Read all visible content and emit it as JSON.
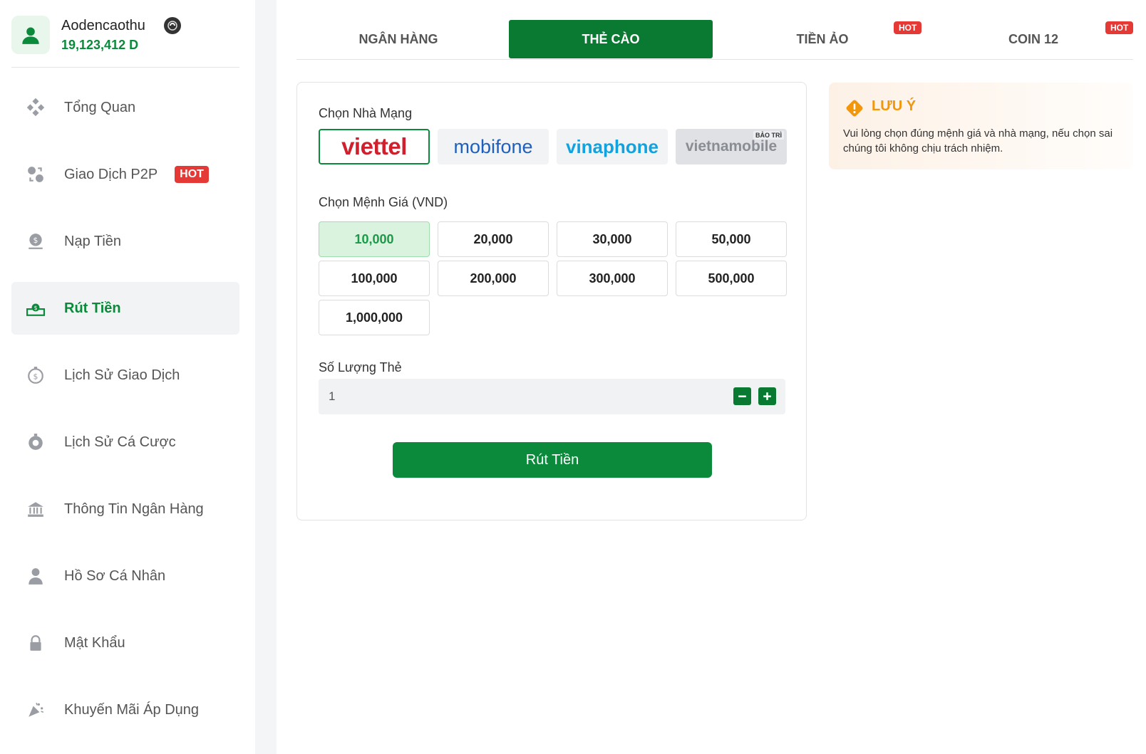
{
  "user": {
    "name": "Aodencaothu",
    "balance": "19,123,412 D"
  },
  "sidebar": {
    "items": [
      {
        "label": "Tổng Quan",
        "icon": "dashboard-icon"
      },
      {
        "label": "Giao Dịch P2P",
        "icon": "p2p-exchange-icon",
        "badge": "HOT"
      },
      {
        "label": "Nạp Tiền",
        "icon": "deposit-icon"
      },
      {
        "label": "Rút Tiền",
        "icon": "withdraw-icon",
        "active": true
      },
      {
        "label": "Lịch Sử Giao Dịch",
        "icon": "transaction-history-icon"
      },
      {
        "label": "Lịch Sử Cá Cược",
        "icon": "bet-history-icon"
      },
      {
        "label": "Thông Tin Ngân Hàng",
        "icon": "bank-icon"
      },
      {
        "label": "Hồ Sơ Cá Nhân",
        "icon": "profile-icon"
      },
      {
        "label": "Mật Khẩu",
        "icon": "lock-icon"
      },
      {
        "label": "Khuyến Mãi Áp Dụng",
        "icon": "promotion-icon"
      }
    ]
  },
  "tabs": [
    {
      "label": "NGÂN HÀNG"
    },
    {
      "label": "THẺ CÀO",
      "active": true
    },
    {
      "label": "TIỀN ẢO",
      "badge": "HOT"
    },
    {
      "label": "COIN 12",
      "badge": "HOT"
    }
  ],
  "form": {
    "carrier_label": "Chọn Nhà Mạng",
    "carriers": [
      {
        "name": "viettel",
        "selected": true
      },
      {
        "name": "mobifone"
      },
      {
        "name": "vinaphone"
      },
      {
        "name": "vietnamobile",
        "badge": "BẢO TRÌ"
      }
    ],
    "denomination_label": "Chọn Mệnh Giá (VND)",
    "denominations": [
      "10,000",
      "20,000",
      "30,000",
      "50,000",
      "100,000",
      "200,000",
      "300,000",
      "500,000",
      "1,000,000"
    ],
    "selected_denomination": "10,000",
    "quantity_label": "Số Lượng Thẻ",
    "quantity_value": "1",
    "submit_label": "Rút Tiền"
  },
  "notice": {
    "title": "LƯU Ý",
    "text": "Vui lòng chọn đúng mệnh giá và nhà mạng, nếu chọn sai chúng tôi không chịu trách nhiệm."
  },
  "colors": {
    "brand_green": "#0a8a3a",
    "hot_red": "#e53935",
    "notice_orange": "#f2960c"
  }
}
